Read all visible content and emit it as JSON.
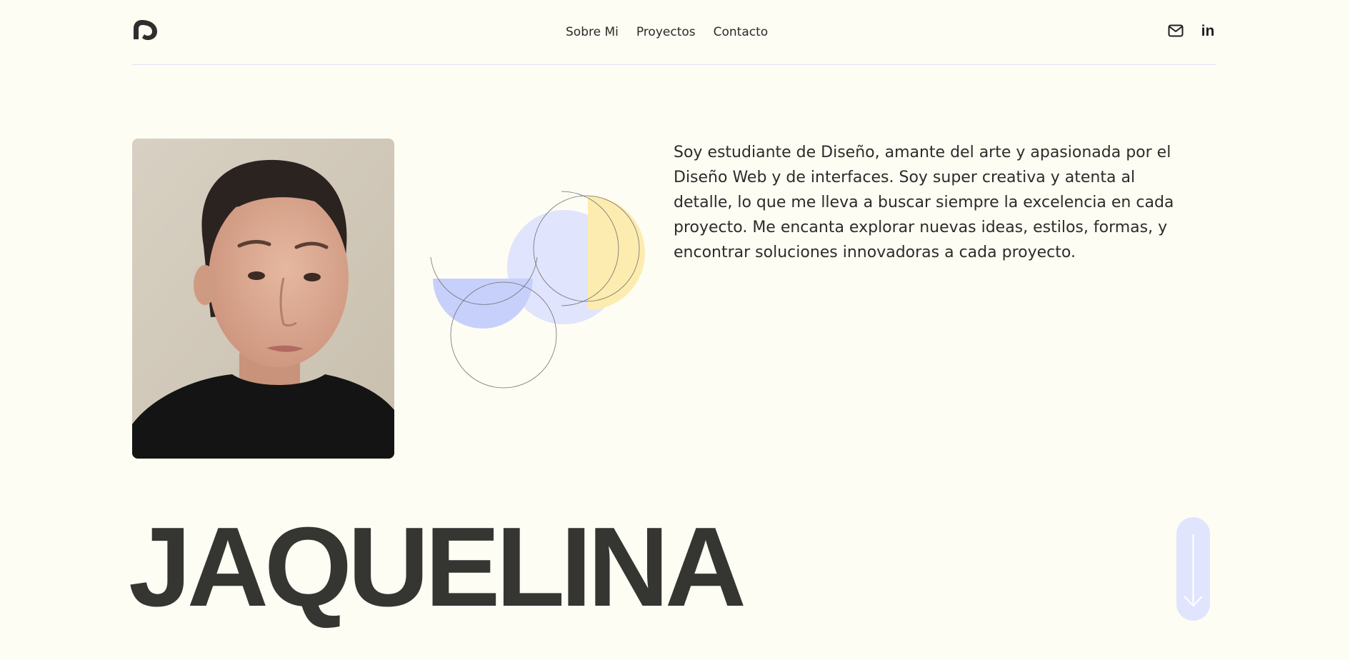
{
  "header": {
    "nav": {
      "about": "Sobre Mi",
      "projects": "Proyectos",
      "contact": "Contacto"
    },
    "social": {
      "email_icon": "envelope-icon",
      "linkedin_icon": "linkedin-icon",
      "linkedin_text": "in"
    },
    "logo_icon": "brand-logo-icon"
  },
  "hero": {
    "bio": "Soy estudiante de Diseño, amante del arte y apasionada por el Diseño Web y de interfaces. Soy super creativa y atenta al detalle, lo que me lleva a buscar siempre la excelencia en cada proyecto. Me encanta explorar nuevas ideas, estilos, formas, y encontrar soluciones innovadoras a cada proyecto.",
    "name": "JAQUELINA",
    "scroll_icon": "arrow-down-icon"
  },
  "colors": {
    "background": "#fdfdf4",
    "text": "#2e2e2c",
    "lavender": "#e0e4fd",
    "periwinkle": "#c6d0fb",
    "yellow": "#fdecaf",
    "divider": "#dfe3fb"
  }
}
